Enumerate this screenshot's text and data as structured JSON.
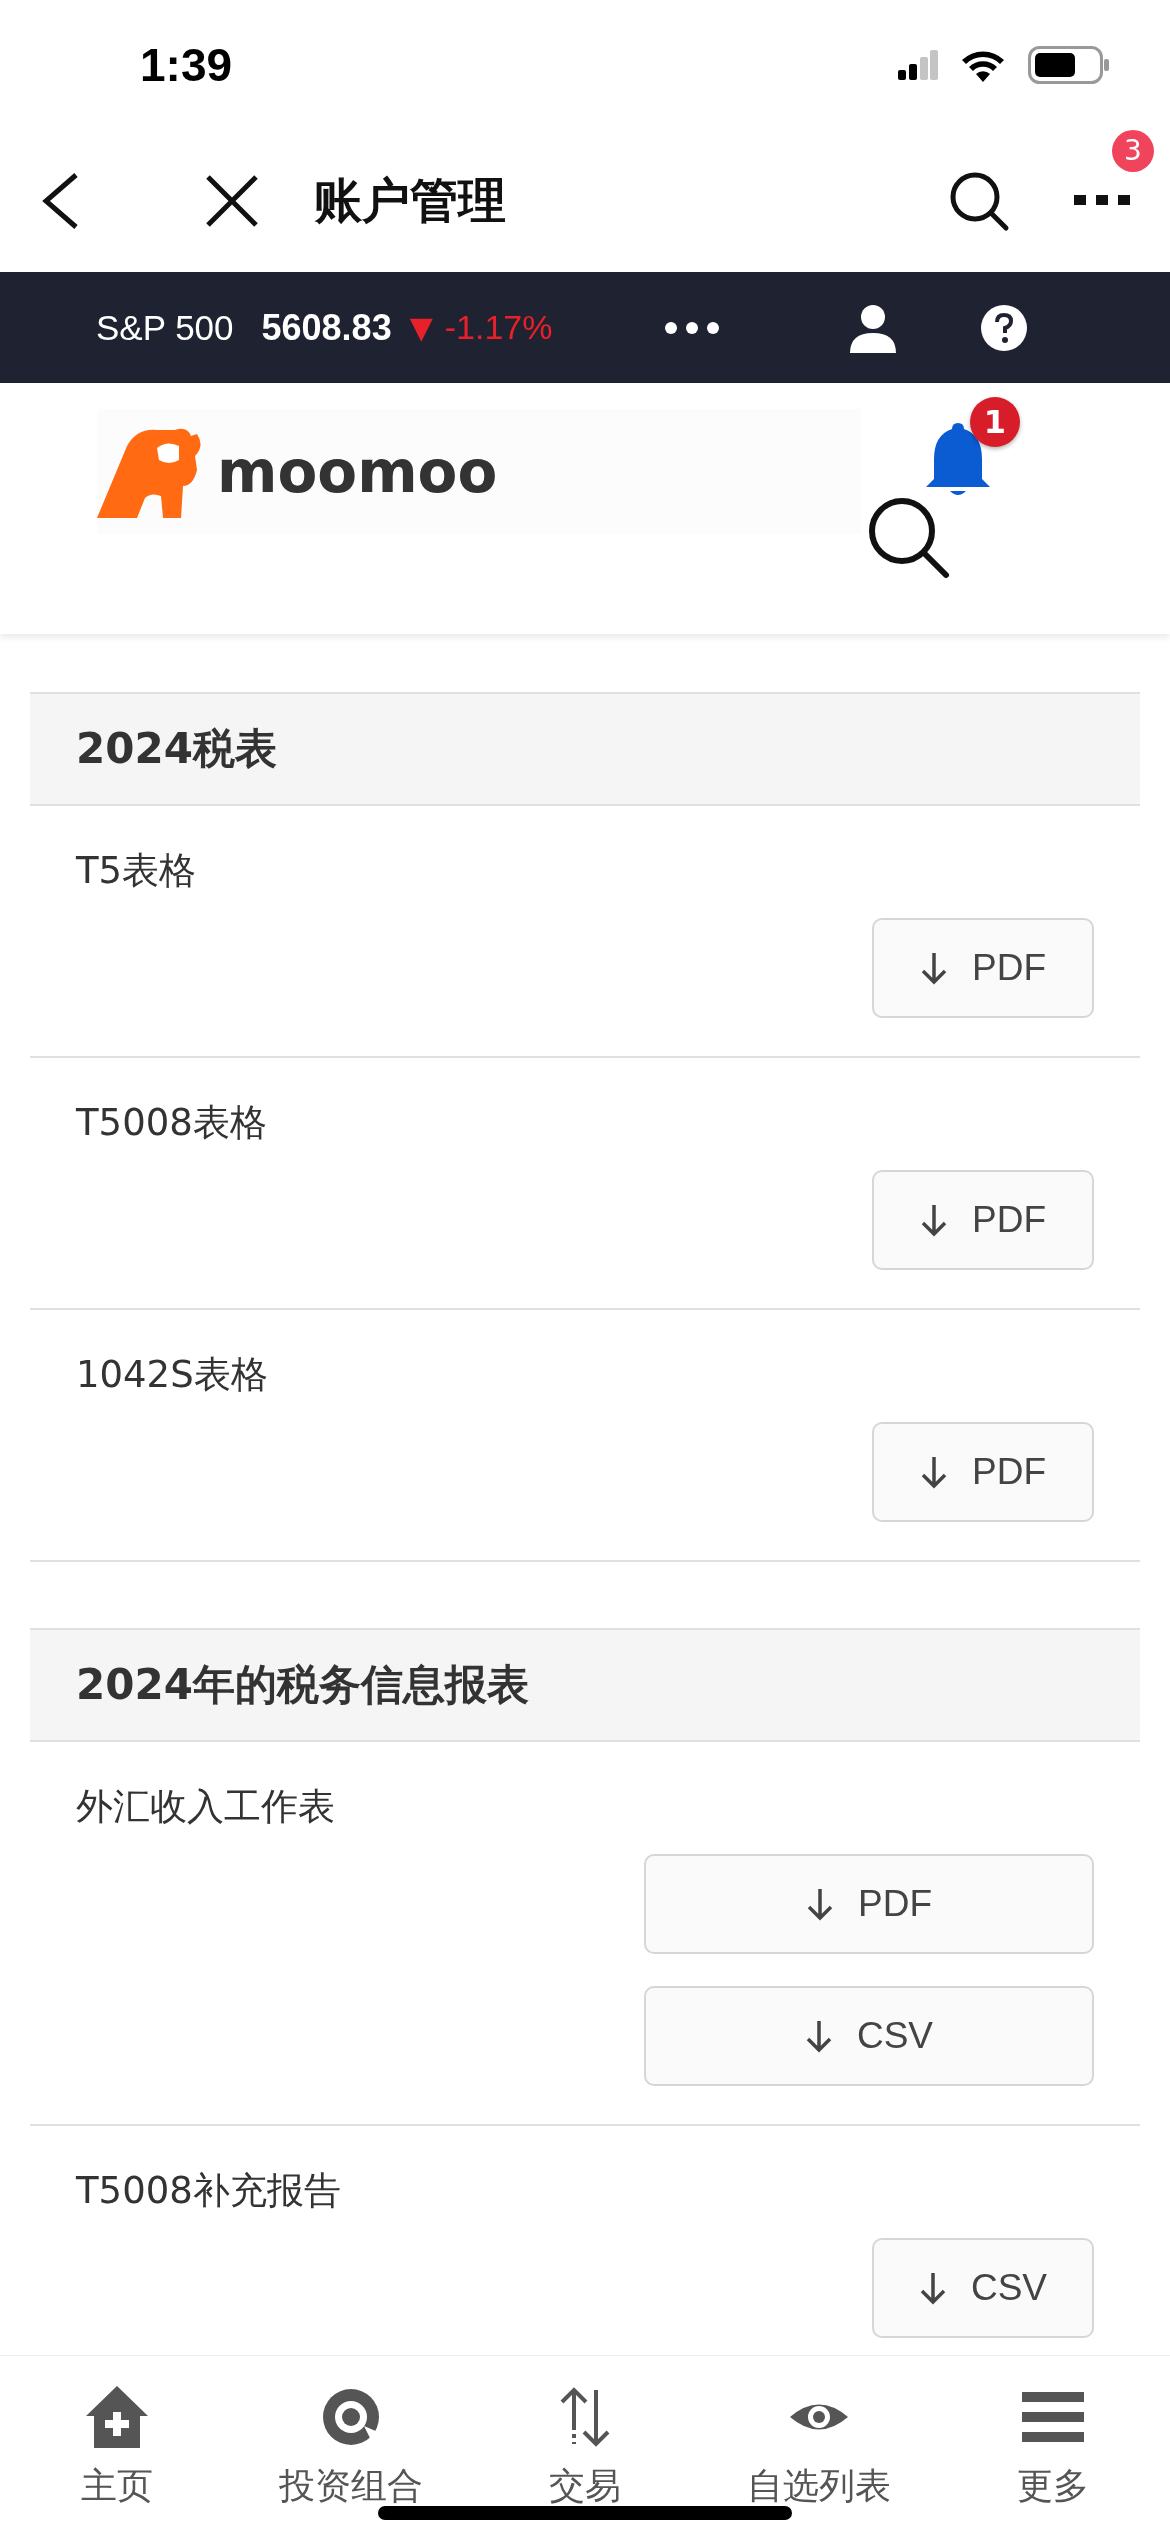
{
  "status_bar": {
    "time": "1:39"
  },
  "nav_bar": {
    "title": "账户管理",
    "more_badge": "3"
  },
  "ticker": {
    "name": "S&P 500",
    "value": "5608.83",
    "arrow": "▼",
    "change": "-1.17%"
  },
  "header": {
    "logo_text": "moomoo",
    "notification_badge": "1"
  },
  "sections": [
    {
      "title": "2024税表",
      "rows": [
        {
          "label": "T5表格",
          "kind": "compact",
          "buttons": [
            {
              "label": "PDF"
            }
          ]
        },
        {
          "label": "T5008表格",
          "kind": "compact",
          "buttons": [
            {
              "label": "PDF"
            }
          ]
        },
        {
          "label": "1042S表格",
          "kind": "compact",
          "buttons": [
            {
              "label": "PDF"
            }
          ]
        }
      ]
    },
    {
      "title": "2024年的税务信息报表",
      "rows": [
        {
          "label": "外汇收入工作表",
          "kind": "wide",
          "buttons": [
            {
              "label": "PDF"
            },
            {
              "label": "CSV"
            }
          ]
        },
        {
          "label": "T5008补充报告",
          "kind": "compact",
          "buttons": [
            {
              "label": "CSV"
            }
          ]
        }
      ]
    }
  ],
  "tab_bar": [
    {
      "label": "主页"
    },
    {
      "label": "投资组合"
    },
    {
      "label": "交易"
    },
    {
      "label": "自选列表"
    },
    {
      "label": "更多"
    }
  ]
}
